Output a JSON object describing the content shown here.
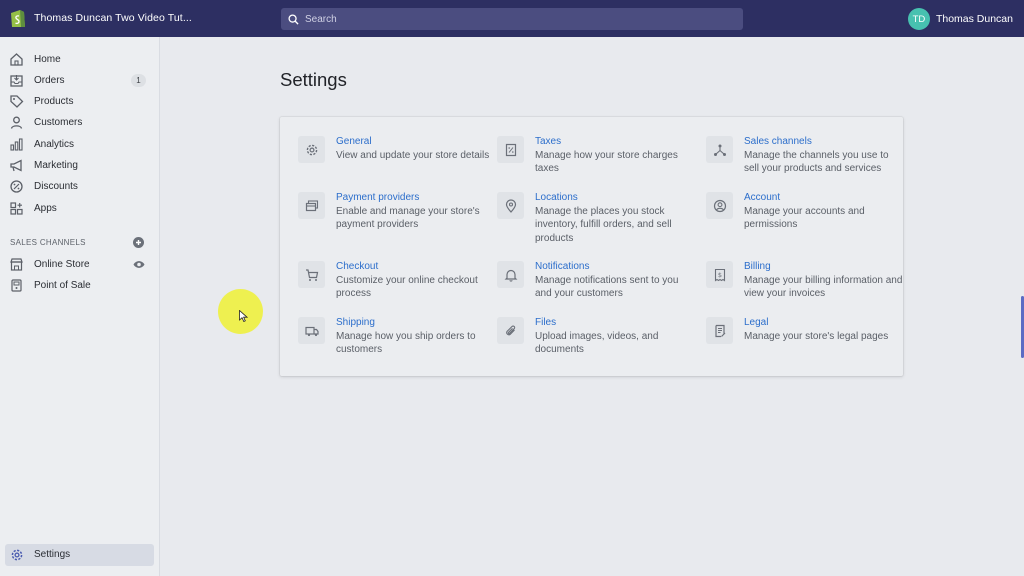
{
  "topbar": {
    "store_name": "Thomas Duncan Two Video Tut...",
    "search_placeholder": "Search",
    "user_initials": "TD",
    "user_name": "Thomas Duncan"
  },
  "sidebar": {
    "items": [
      {
        "label": "Home",
        "icon": "home-icon"
      },
      {
        "label": "Orders",
        "icon": "orders-icon",
        "badge": "1"
      },
      {
        "label": "Products",
        "icon": "tag-icon"
      },
      {
        "label": "Customers",
        "icon": "customer-icon"
      },
      {
        "label": "Analytics",
        "icon": "bar-chart-icon"
      },
      {
        "label": "Marketing",
        "icon": "megaphone-icon"
      },
      {
        "label": "Discounts",
        "icon": "discount-icon"
      },
      {
        "label": "Apps",
        "icon": "apps-icon"
      }
    ],
    "sales_channels_title": "SALES CHANNELS",
    "channels": [
      {
        "label": "Online Store",
        "icon": "store-icon"
      },
      {
        "label": "Point of Sale",
        "icon": "pos-icon"
      }
    ],
    "settings_label": "Settings"
  },
  "main": {
    "title": "Settings",
    "settings": [
      {
        "title": "General",
        "desc": "View and update your store details",
        "icon": "gear-icon"
      },
      {
        "title": "Taxes",
        "desc": "Manage how your store charges taxes",
        "icon": "receipt-icon"
      },
      {
        "title": "Sales channels",
        "desc": "Manage the channels you use to sell your products and services",
        "icon": "channels-icon"
      },
      {
        "title": "Payment providers",
        "desc": "Enable and manage your store's payment providers",
        "icon": "credit-card-icon"
      },
      {
        "title": "Locations",
        "desc": "Manage the places you stock inventory, fulfill orders, and sell products",
        "icon": "location-pin-icon"
      },
      {
        "title": "Account",
        "desc": "Manage your accounts and permissions",
        "icon": "account-icon"
      },
      {
        "title": "Checkout",
        "desc": "Customize your online checkout process",
        "icon": "cart-icon"
      },
      {
        "title": "Notifications",
        "desc": "Manage notifications sent to you and your customers",
        "icon": "bell-icon"
      },
      {
        "title": "Billing",
        "desc": "Manage your billing information and view your invoices",
        "icon": "billing-icon"
      },
      {
        "title": "Shipping",
        "desc": "Manage how you ship orders to customers",
        "icon": "truck-icon"
      },
      {
        "title": "Files",
        "desc": "Upload images, videos, and documents",
        "icon": "paperclip-icon"
      },
      {
        "title": "Legal",
        "desc": "Manage your store's legal pages",
        "icon": "legal-icon"
      }
    ]
  },
  "colors": {
    "topbar": "#2d2f62",
    "link": "#2c6ecb",
    "avatar": "#47c1b0"
  }
}
